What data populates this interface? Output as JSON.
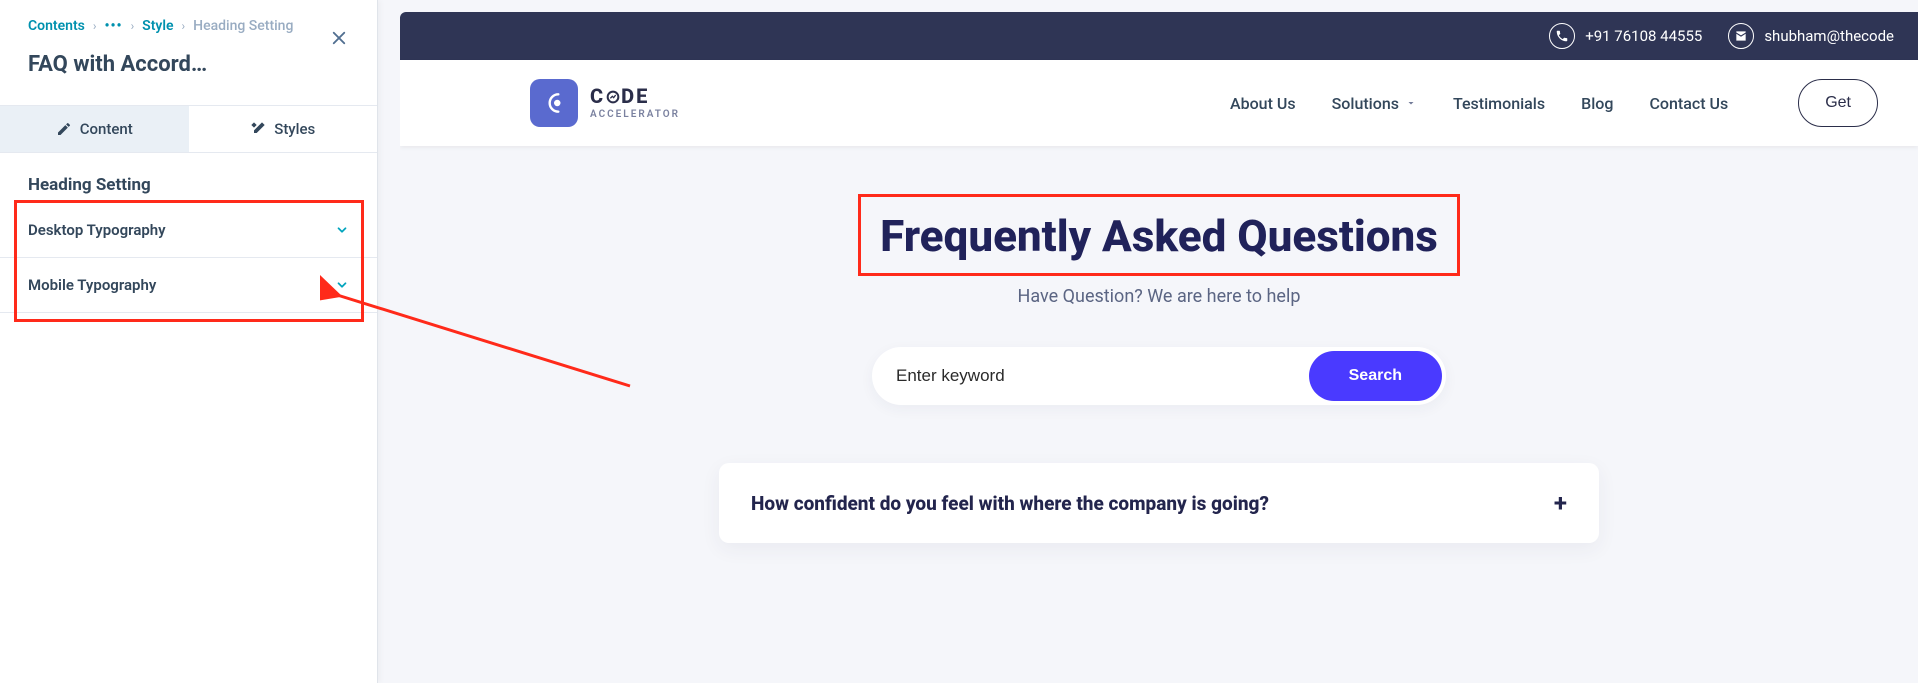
{
  "editor": {
    "breadcrumb": {
      "root": "Contents",
      "mid": "Style",
      "current": "Heading Setting"
    },
    "title": "FAQ with Accord…",
    "tabs": {
      "content": "Content",
      "styles": "Styles"
    },
    "section_heading": "Heading Setting",
    "accordions": {
      "desktop": "Desktop Typography",
      "mobile": "Mobile Typography"
    }
  },
  "preview": {
    "topbar": {
      "phone": "+91 76108 44555",
      "email": "shubham@thecode"
    },
    "brand": {
      "name_pre": "C",
      "name_post": "DE",
      "tagline": "ACCELERATOR"
    },
    "nav": {
      "about": "About Us",
      "solutions": "Solutions",
      "testimonials": "Testimonials",
      "blog": "Blog",
      "contact": "Contact Us",
      "cta": "Get"
    },
    "faq": {
      "heading": "Frequently Asked Questions",
      "subtitle": "Have Question? We are here to help",
      "search_placeholder": "Enter keyword",
      "search_button": "Search",
      "q1": "How confident do you feel with where the company is going?"
    }
  }
}
